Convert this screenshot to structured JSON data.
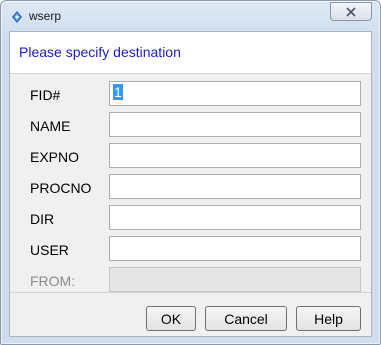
{
  "window": {
    "title": "wserp",
    "icon": "app-icon",
    "close_icon": "close-icon"
  },
  "header": {
    "text": "Please specify destination"
  },
  "fields": [
    {
      "label": "FID#",
      "value": "1",
      "enabled": true,
      "selected": true
    },
    {
      "label": "NAME",
      "value": "",
      "enabled": true
    },
    {
      "label": "EXPNO",
      "value": "",
      "enabled": true
    },
    {
      "label": "PROCNO",
      "value": "",
      "enabled": true
    },
    {
      "label": "DIR",
      "value": "",
      "enabled": true
    },
    {
      "label": "USER",
      "value": "",
      "enabled": true
    },
    {
      "label": "FROM:",
      "value": "",
      "enabled": false
    }
  ],
  "buttons": {
    "ok": "OK",
    "cancel": "Cancel",
    "help": "Help"
  },
  "colors": {
    "header_text": "#1b1bd0",
    "selection": "#3399ff",
    "disabled_label": "#8c8c8c"
  }
}
